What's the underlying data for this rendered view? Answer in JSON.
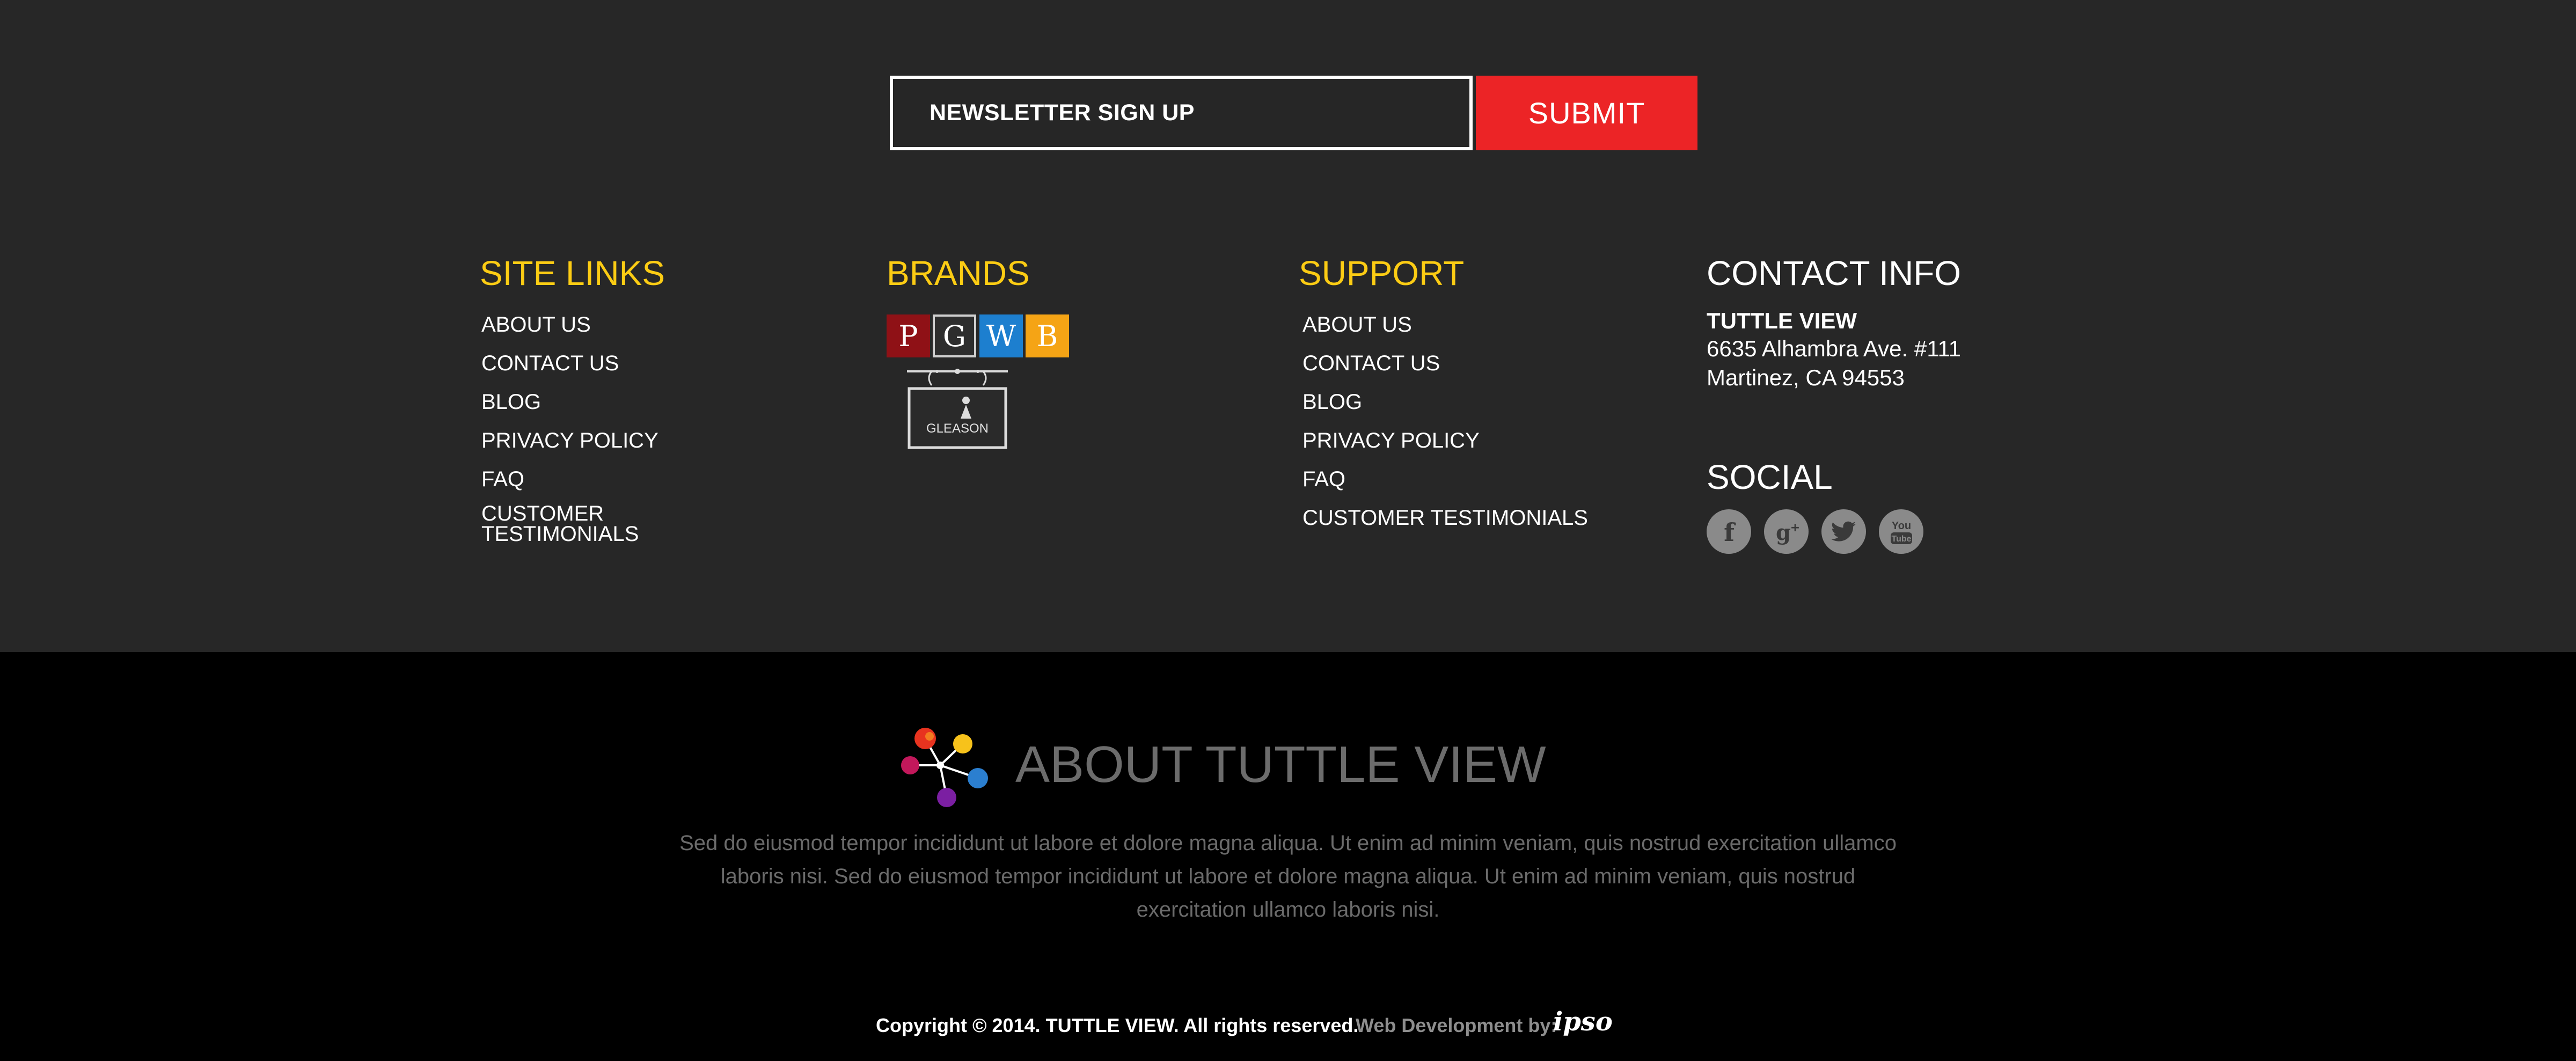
{
  "newsletter": {
    "field_label": "NEWSLETTER SIGN UP",
    "submit_label": "SUBMIT"
  },
  "site_links": {
    "heading": "SITE LINKS",
    "items": [
      "ABOUT US",
      "CONTACT US",
      "BLOG",
      "PRIVACY POLICY",
      "FAQ",
      "CUSTOMER TESTIMONIALS"
    ]
  },
  "brands": {
    "heading": "BRANDS",
    "tiles": [
      {
        "letter": "P",
        "color": "#8f1116"
      },
      {
        "letter": "G",
        "color": "#2d2d2d"
      },
      {
        "letter": "W",
        "color": "#1d7fcf"
      },
      {
        "letter": "B",
        "color": "#f5a415"
      }
    ],
    "gleason_logo": "GLEASON"
  },
  "support": {
    "heading": "SUPPORT",
    "items": [
      "ABOUT US",
      "CONTACT US",
      "BLOG",
      "PRIVACY POLICY",
      "FAQ",
      "CUSTOMER TESTIMONIALS"
    ]
  },
  "contact": {
    "heading": "CONTACT INFO",
    "name": "TUTTLE VIEW",
    "address1": "6635 Alhambra Ave. #111",
    "address2": "Martinez, CA 94553"
  },
  "social": {
    "heading": "SOCIAL",
    "icons": [
      "facebook-icon",
      "google-plus-icon",
      "twitter-icon",
      "youtube-icon"
    ]
  },
  "about": {
    "title": "ABOUT TUTTLE VIEW",
    "text": "Sed do eiusmod tempor incididunt ut labore et dolore magna aliqua. Ut enim ad minim veniam, quis nostrud exercitation ullamco laboris nisi. Sed do eiusmod tempor incididunt ut labore et dolore magna aliqua. Ut enim ad minim veniam, quis nostrud exercitation ullamco laboris nisi."
  },
  "footer": {
    "copyright": "Copyright © 2014. TUTTLE VIEW. All rights reserved.",
    "webdev_label": "Web Development by:",
    "webdev_brand": "ipso"
  },
  "colors": {
    "accent_yellow": "#fccc14",
    "submit_red": "#ec2426",
    "upper_bg": "#272727",
    "lower_bg": "#000000"
  }
}
